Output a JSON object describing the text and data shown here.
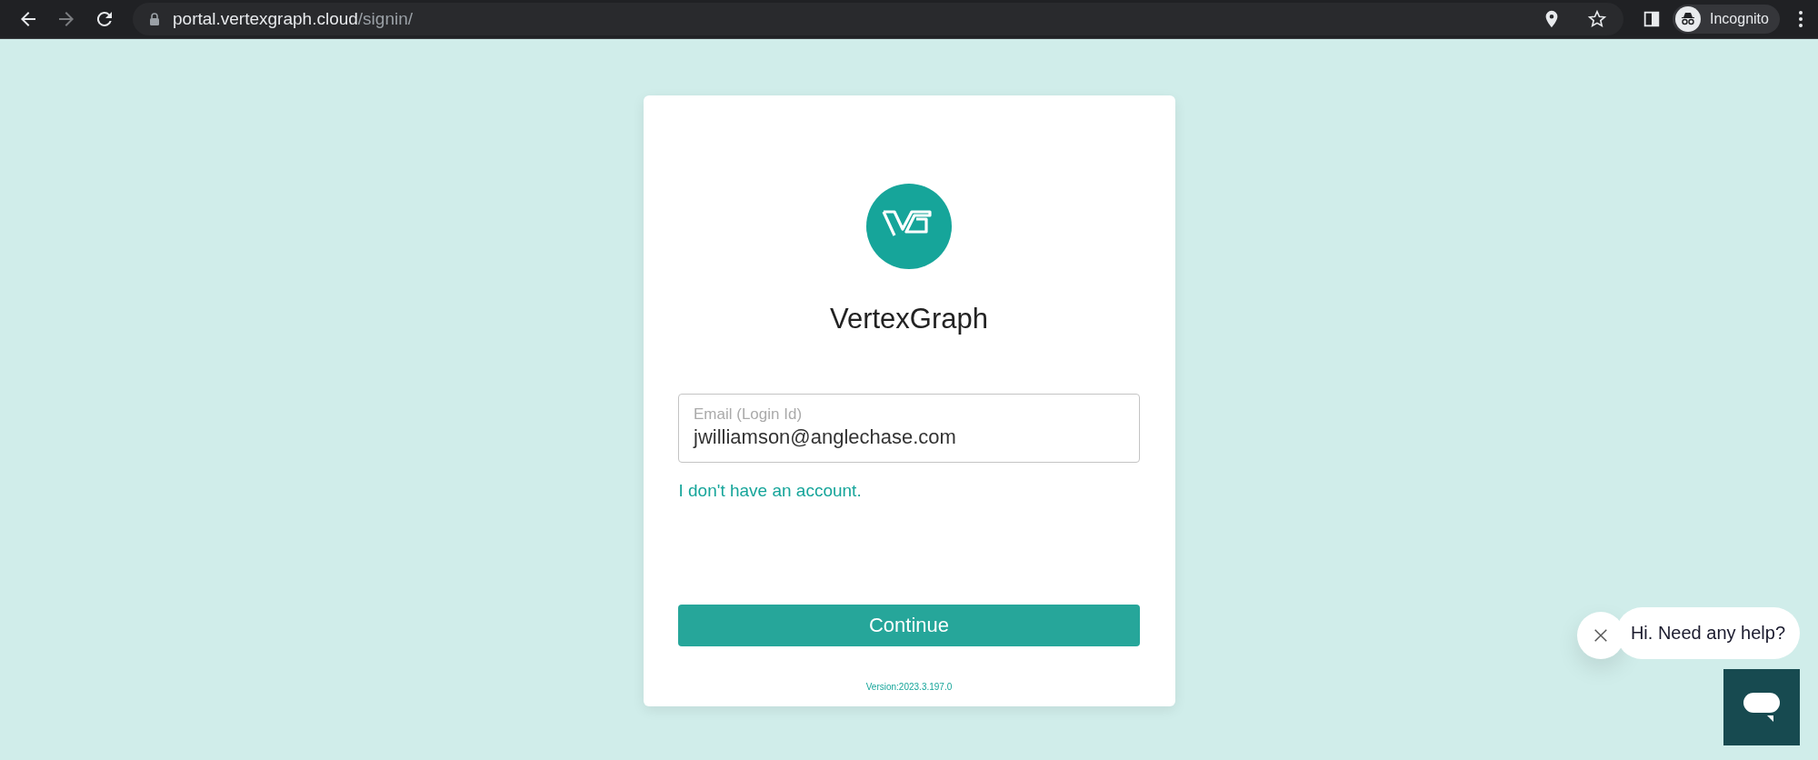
{
  "browser": {
    "url_host": "portal.vertexgraph.cloud",
    "url_path": "/signin/",
    "profile_label": "Incognito"
  },
  "card": {
    "app_name": "VertexGraph",
    "email_field": {
      "placeholder": "Email (Login Id)",
      "value": "jwilliamson@anglechase.com"
    },
    "no_account_link": "I don't have an account.",
    "continue_button": "Continue",
    "version": "Version:2023.3.197.0"
  },
  "chat": {
    "greeting": "Hi. Need any help?"
  }
}
